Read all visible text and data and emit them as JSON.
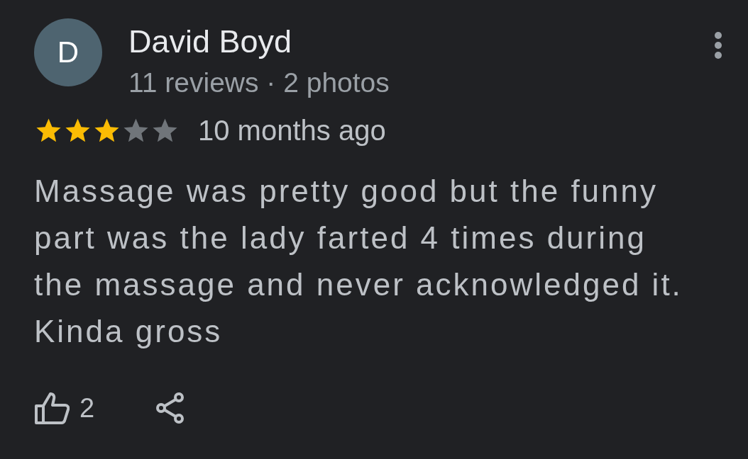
{
  "review": {
    "avatar_letter": "D",
    "author": "David Boyd",
    "meta": "11 reviews · 2 photos",
    "stars": 3,
    "time": "10 months ago",
    "text": "Massage was pretty good but the funny part was the lady farted 4 times during the massage and never acknowledged it. Kinda gross",
    "likes": "2"
  }
}
